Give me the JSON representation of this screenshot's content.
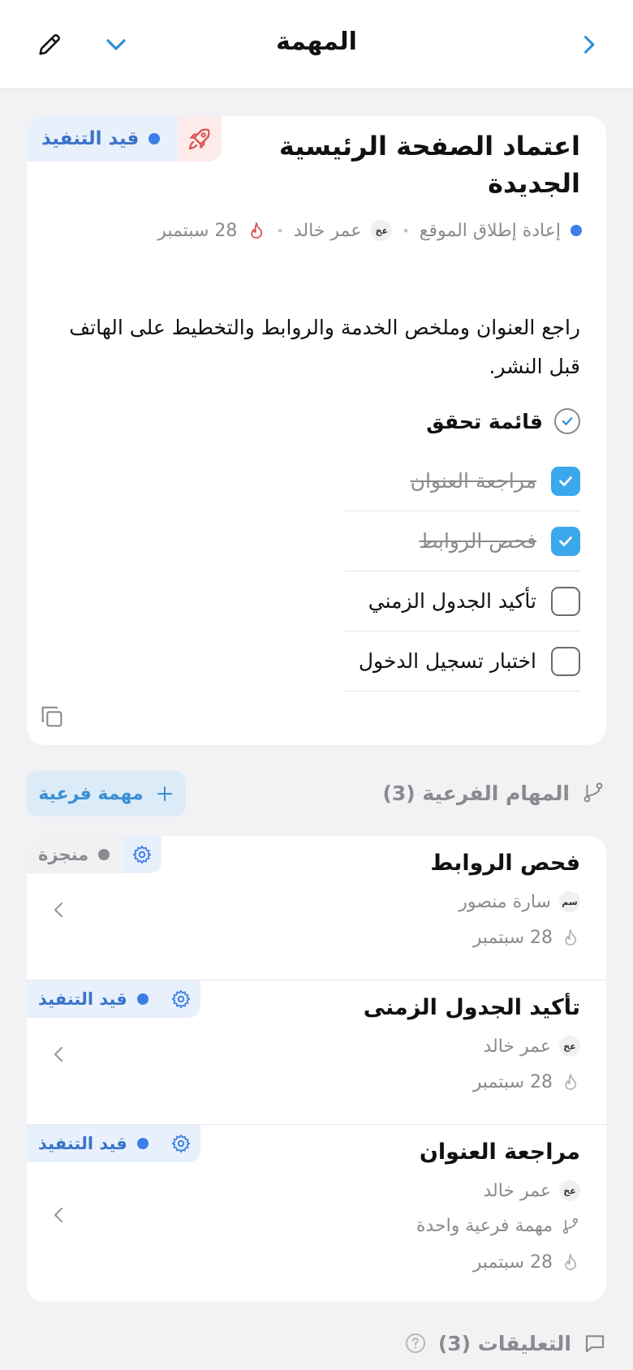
{
  "header": {
    "title": "المهمة"
  },
  "task": {
    "status": "قيد التنفيذ",
    "title": "اعتماد الصفحة الرئيسية الجديدة",
    "project": "إعادة إطلاق الموقع",
    "assignee_initials": "عخ",
    "assignee": "عمر خالد",
    "due": "28 سبتمبر",
    "description": "راجع العنوان وملخص الخدمة والروابط والتخطيط على الهاتف قبل النشر.",
    "checklist_title": "قائمة تحقق",
    "checklist": [
      {
        "label": "مراجعة العنوان",
        "done": true
      },
      {
        "label": "فحص الروابط",
        "done": true
      },
      {
        "label": "تأكيد الجدول الزمني",
        "done": false
      },
      {
        "label": "اختبار تسجيل الدخول",
        "done": false
      }
    ]
  },
  "subtasks": {
    "header": "المهام الفرعية (3)",
    "add_label": "مهمة فرعية",
    "items": [
      {
        "title": "فحص الروابط",
        "status": "منجزة",
        "assignee_initials": "سم",
        "assignee": "سارة منصور",
        "due": "28 سبتمبر"
      },
      {
        "title": "تأكيد الجدول الزمنى",
        "status": "قيد التنفيذ",
        "assignee_initials": "عخ",
        "assignee": "عمر خالد",
        "due": "28 سبتمبر"
      },
      {
        "title": "مراجعة العنوان",
        "status": "قيد التنفيذ",
        "assignee_initials": "عخ",
        "assignee": "عمر خالد",
        "subtask_count": "مهمة فرعية واحدة",
        "due": "28 سبتمبر"
      }
    ]
  },
  "comments": {
    "label": "التعليقات (3)"
  },
  "icons": {
    "back": "chevron-right-icon",
    "dropdown": "chevron-down-icon",
    "edit": "pencil-icon",
    "rocket": "rocket-icon",
    "flame": "flame-icon",
    "gear": "gear-icon",
    "branch": "branch-icon",
    "copy": "copy-icon",
    "comment": "comment-icon",
    "help": "help-circle-icon"
  },
  "colors": {
    "accent": "#3ba7ec",
    "status_blue": "#3b7ee8",
    "status_done": "#8a8a8f",
    "flame_red": "#d9534f"
  }
}
